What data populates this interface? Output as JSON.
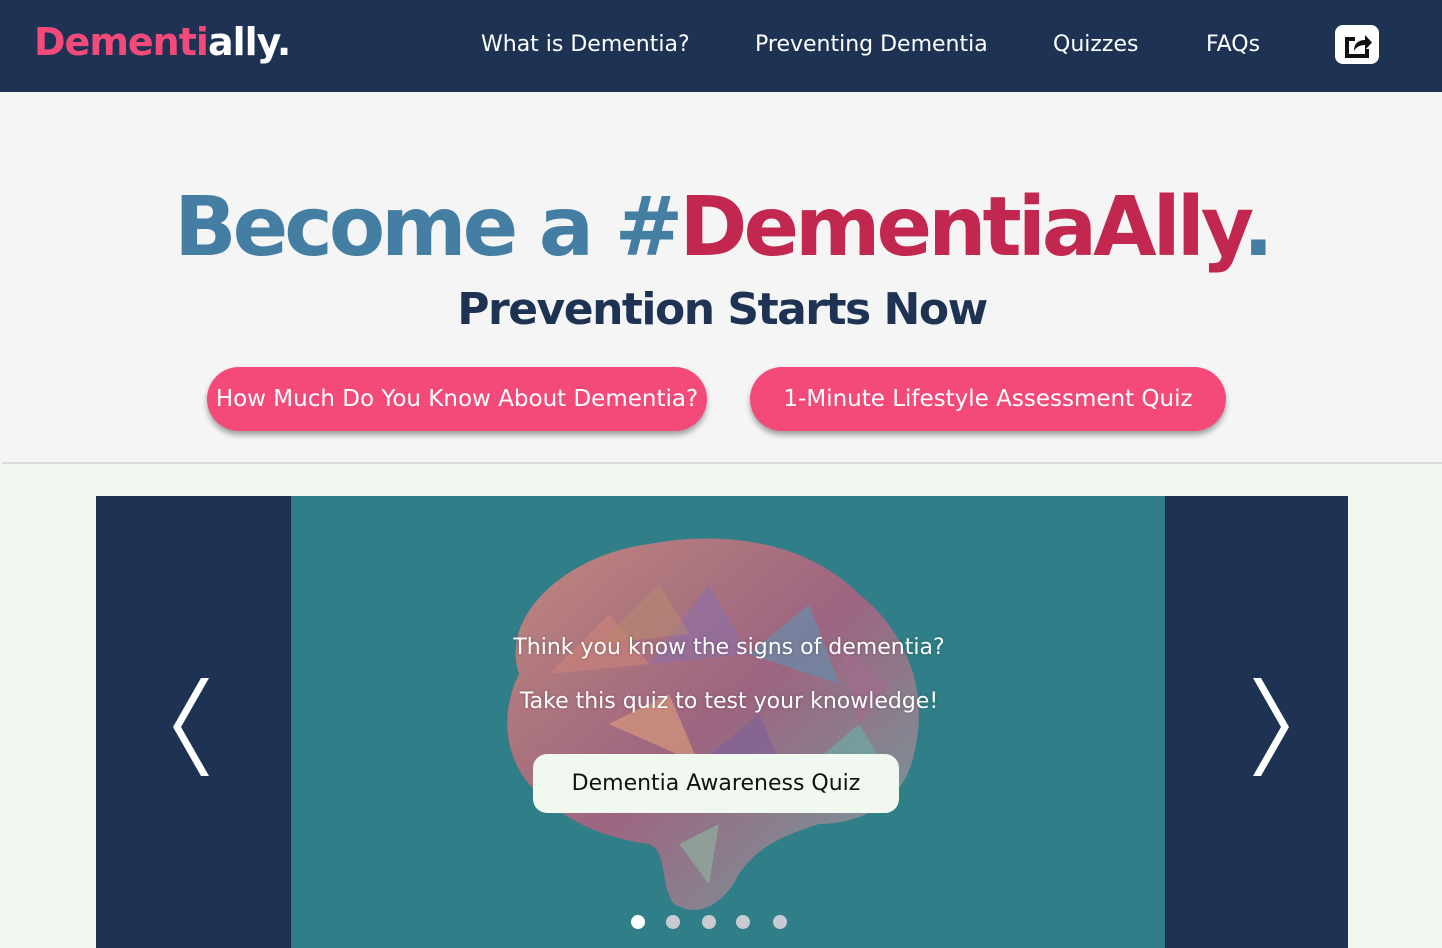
{
  "nav": {
    "logo_part1": "Dementi",
    "logo_part2": "ally.",
    "links": [
      "What is Dementia?",
      "Preventing Dementia",
      "Quizzes",
      "FAQs"
    ],
    "share_icon": "share-icon"
  },
  "hero": {
    "title_part1": "Become a #",
    "title_part2": "DementiaAlly",
    "title_part3": ".",
    "subtitle": "Prevention Starts Now",
    "buttons": [
      "How Much Do You Know About Dementia?",
      "1-Minute Lifestyle Assessment Quiz"
    ]
  },
  "carousel": {
    "line1": "Think you know the signs of dementia?",
    "line2": "Take this quiz to test your knowledge!",
    "button_label": "Dementia Awareness Quiz",
    "slide_count": 5,
    "active_slide": 1,
    "prev_icon": "chevron-left-icon",
    "next_icon": "chevron-right-icon",
    "image": "brain-illustration"
  },
  "colors": {
    "navy": "#1e3354",
    "pink": "#f44a7a",
    "crimson": "#c2274f",
    "steel_blue": "#447ea3",
    "teal": "#307e87"
  }
}
